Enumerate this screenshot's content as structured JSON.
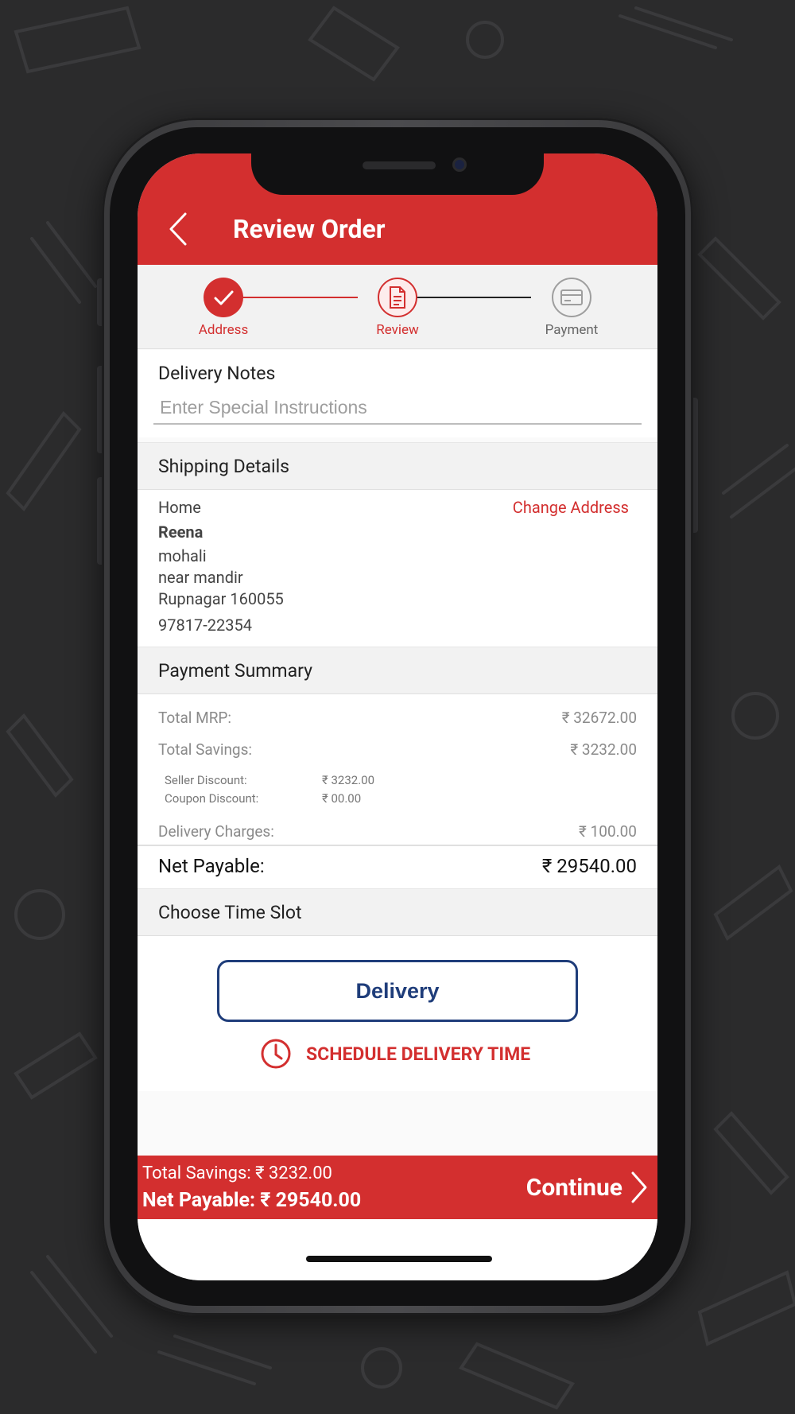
{
  "header": {
    "title": "Review Order"
  },
  "stepper": {
    "steps": [
      {
        "label": "Address",
        "state": "done"
      },
      {
        "label": "Review",
        "state": "active"
      },
      {
        "label": "Payment",
        "state": "pending"
      }
    ]
  },
  "delivery_notes": {
    "title": "Delivery Notes",
    "placeholder": "Enter Special Instructions",
    "value": ""
  },
  "shipping": {
    "title": "Shipping Details",
    "address_type": "Home",
    "change_label": "Change Address",
    "name": "Reena",
    "line1": "mohali",
    "line2": "near mandir",
    "line3": "Rupnagar 160055",
    "phone": "97817-22354"
  },
  "payment": {
    "title": "Payment Summary",
    "total_mrp_label": "Total MRP:",
    "total_mrp": "₹ 32672.00",
    "total_savings_label": "Total Savings:",
    "total_savings": "₹ 3232.00",
    "seller_discount_label": "Seller Discount:",
    "seller_discount": "₹ 3232.00",
    "coupon_discount_label": "Coupon Discount:",
    "coupon_discount": "₹ 00.00",
    "delivery_charges_label": "Delivery Charges:",
    "delivery_charges": "₹ 100.00",
    "net_payable_label": "Net Payable:",
    "net_payable": "₹ 29540.00"
  },
  "timeslot": {
    "title": "Choose Time Slot",
    "delivery_button": "Delivery",
    "schedule_label": "SCHEDULE DELIVERY TIME"
  },
  "footer": {
    "total_savings": "Total Savings: ₹ 3232.00",
    "net_payable": "Net Payable: ₹ 29540.00",
    "continue_label": "Continue"
  },
  "colors": {
    "brand_red": "#d32f2f",
    "delivery_blue": "#1f3d7a",
    "background": "#2b2b2c"
  }
}
